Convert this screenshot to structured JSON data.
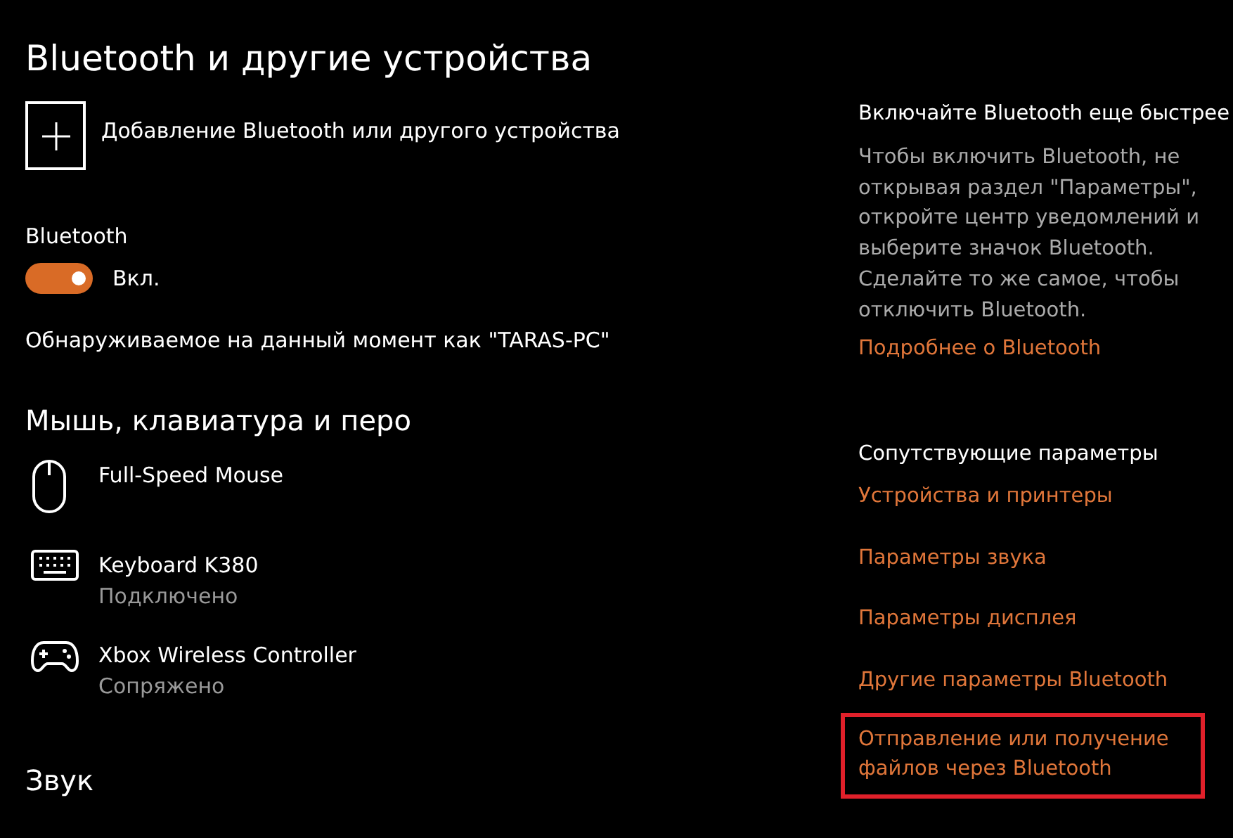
{
  "title": "Bluetooth и другие устройства",
  "add_device": {
    "label": "Добавление Bluetooth или другого устройства"
  },
  "bluetooth": {
    "label": "Bluetooth",
    "on": true,
    "state_text": "Вкл."
  },
  "discoverable": "Обнаруживаемое на данный момент как \"TARAS-PC\"",
  "section_heading": "Мышь, клавиатура и перо",
  "devices": [
    {
      "kind": "mouse",
      "name": "Full-Speed Mouse"
    },
    {
      "kind": "keyboard",
      "name": "Keyboard K380",
      "status": "Подключено"
    },
    {
      "kind": "gamepad",
      "name": "Xbox Wireless Controller",
      "status": "Сопряжено"
    }
  ],
  "next_section_heading": "Звук",
  "tip": {
    "heading": "Включайте Bluetooth еще быстрее",
    "text": "Чтобы включить Bluetooth, не открывая раздел \"Параметры\", откройте центр уведомлений и выберите значок Bluetooth. Сделайте то же самое, чтобы отключить Bluetooth.",
    "link": "Подробнее о Bluetooth"
  },
  "related": {
    "heading": "Сопутствующие параметры",
    "links": [
      {
        "label": "Устройства и принтеры",
        "highlighted": false
      },
      {
        "label": "Параметры звука",
        "highlighted": false
      },
      {
        "label": "Параметры дисплея",
        "highlighted": false
      },
      {
        "label": "Другие параметры Bluetooth",
        "highlighted": false
      },
      {
        "label": "Отправление или получение файлов через Bluetooth",
        "highlighted": true
      }
    ]
  }
}
